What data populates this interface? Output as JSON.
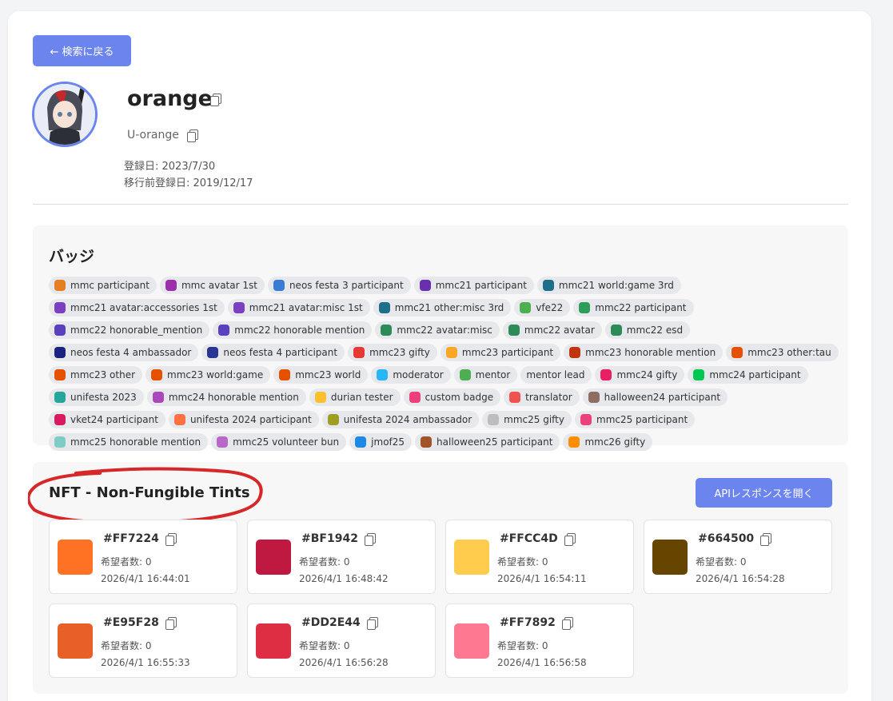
{
  "back_button_label": "← 検索に戻る",
  "profile": {
    "username": "orange",
    "user_id": "U-orange",
    "registered": "登録日: 2023/7/30",
    "registered_before_migration": "移行前登録日: 2019/12/17"
  },
  "badges": {
    "title": "バッジ",
    "items": [
      {
        "label": "mmc participant",
        "color": "#e67e22"
      },
      {
        "label": "mmc avatar 1st",
        "color": "#9b2fae"
      },
      {
        "label": "neos festa 3 participant",
        "color": "#3a7bd5"
      },
      {
        "label": "mmc21 participant",
        "color": "#6a2fae"
      },
      {
        "label": "mmc21 world:game 3rd",
        "color": "#1f6f8b"
      },
      {
        "label": "mmc21 avatar:accessories 1st",
        "color": "#7b3fbf"
      },
      {
        "label": "mmc21 avatar:misc 1st",
        "color": "#7b3fbf"
      },
      {
        "label": "mmc21 other:misc 3rd",
        "color": "#1f6f8b"
      },
      {
        "label": "vfe22",
        "color": "#4caf50"
      },
      {
        "label": "mmc22 participant",
        "color": "#2e9d5b"
      },
      {
        "label": "mmc22 honorable_mention",
        "color": "#5a3fbf"
      },
      {
        "label": "mmc22 honorable mention",
        "color": "#5a3fbf"
      },
      {
        "label": "mmc22 avatar:misc",
        "color": "#2e8b57"
      },
      {
        "label": "mmc22 avatar",
        "color": "#2e8b57"
      },
      {
        "label": "mmc22 esd",
        "color": "#2e8b57"
      },
      {
        "label": "neos festa 4 ambassador",
        "color": "#1a237e"
      },
      {
        "label": "neos festa 4 participant",
        "color": "#283593"
      },
      {
        "label": "mmc23 gifty",
        "color": "#e53935"
      },
      {
        "label": "mmc23 participant",
        "color": "#f9a825"
      },
      {
        "label": "mmc23 honorable mention",
        "color": "#bf360c"
      },
      {
        "label": "mmc23 other:tau",
        "color": "#e65100"
      },
      {
        "label": "mmc23 other",
        "color": "#e65100"
      },
      {
        "label": "mmc23 world:game",
        "color": "#e65100"
      },
      {
        "label": "mmc23 world",
        "color": "#e65100"
      },
      {
        "label": "moderator",
        "color": "#29b6f6"
      },
      {
        "label": "mentor",
        "color": "#4caf50"
      },
      {
        "label": "mentor lead",
        "color": ""
      },
      {
        "label": "mmc24 gifty",
        "color": "#e91e63"
      },
      {
        "label": "mmc24 participant",
        "color": "#00c853"
      },
      {
        "label": "unifesta 2023",
        "color": "#26a69a"
      },
      {
        "label": "mmc24 honorable mention",
        "color": "#ab47bc"
      },
      {
        "label": "durian tester",
        "color": "#fbc02d"
      },
      {
        "label": "custom badge",
        "color": "#ec407a"
      },
      {
        "label": "translator",
        "color": "#ef5350"
      },
      {
        "label": "halloween24 participant",
        "color": "#8d6e63"
      },
      {
        "label": "vket24 participant",
        "color": "#d81b60"
      },
      {
        "label": "unifesta 2024 participant",
        "color": "#ff7043"
      },
      {
        "label": "unifesta 2024 ambassador",
        "color": "#9e9d24"
      },
      {
        "label": "mmc25 gifty",
        "color": "#bdbdbd"
      },
      {
        "label": "mmc25 participant",
        "color": "#ec407a"
      },
      {
        "label": "mmc25 honorable mention",
        "color": "#80cbc4"
      },
      {
        "label": "mmc25 volunteer bun",
        "color": "#ba68c8"
      },
      {
        "label": "jmof25",
        "color": "#1e88e5"
      },
      {
        "label": "halloween25 participant",
        "color": "#a1532a"
      },
      {
        "label": "mmc26 gifty",
        "color": "#ff8f00"
      }
    ]
  },
  "nft": {
    "title": "NFT - Non-Fungible Tints",
    "api_button_label": "APIレスポンスを開く",
    "tints": [
      {
        "hex": "#FF7224",
        "wish": "希望者数: 0",
        "date": "2026/4/1 16:44:01",
        "color": "#FF7224"
      },
      {
        "hex": "#BF1942",
        "wish": "希望者数: 0",
        "date": "2026/4/1 16:48:42",
        "color": "#BF1942"
      },
      {
        "hex": "#FFCC4D",
        "wish": "希望者数: 0",
        "date": "2026/4/1 16:54:11",
        "color": "#FFCC4D"
      },
      {
        "hex": "#664500",
        "wish": "希望者数: 0",
        "date": "2026/4/1 16:54:28",
        "color": "#664500"
      },
      {
        "hex": "#E95F28",
        "wish": "希望者数: 0",
        "date": "2026/4/1 16:55:33",
        "color": "#E95F28"
      },
      {
        "hex": "#DD2E44",
        "wish": "希望者数: 0",
        "date": "2026/4/1 16:56:28",
        "color": "#DD2E44"
      },
      {
        "hex": "#FF7892",
        "wish": "希望者数: 0",
        "date": "2026/4/1 16:56:58",
        "color": "#FF7892"
      }
    ]
  },
  "colors": {
    "accent": "#6c84ee",
    "annotation": "#d62828"
  }
}
